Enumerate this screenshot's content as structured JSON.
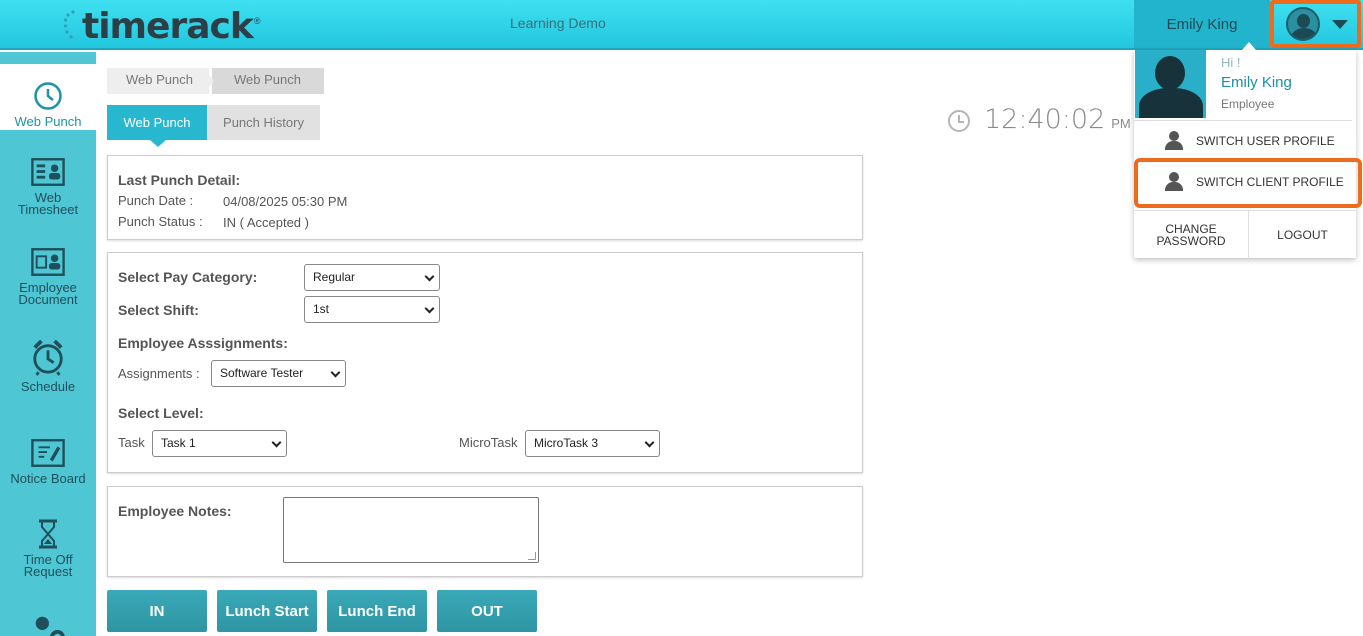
{
  "header": {
    "logo_text": "timerack",
    "logo_reg": "®",
    "org_name": "Learning Demo",
    "user_name": "Emily King"
  },
  "sidebar": {
    "items": [
      {
        "label": "Web Punch",
        "icon": "clock-icon",
        "active": true
      },
      {
        "label": "Web Timesheet",
        "icon": "timesheet-icon"
      },
      {
        "label": "Employee Document",
        "icon": "document-icon"
      },
      {
        "label": "Schedule",
        "icon": "alarm-clock-icon"
      },
      {
        "label": "Notice Board",
        "icon": "notice-board-icon"
      },
      {
        "label": "Time Off Request",
        "icon": "hourglass-icon"
      },
      {
        "label": "",
        "icon": "user-settings-icon"
      }
    ]
  },
  "breadcrumb": [
    "Web Punch",
    "Web Punch"
  ],
  "tabs": [
    {
      "label": "Web Punch",
      "active": true
    },
    {
      "label": "Punch History",
      "active": false
    }
  ],
  "clock": {
    "time": "12:40:02",
    "ampm": "PM"
  },
  "last_punch": {
    "title": "Last Punch Detail:",
    "date_label": "Punch Date :",
    "date_value": "04/08/2025 05:30 PM",
    "status_label": "Punch Status :",
    "status_value": "IN ( Accepted )"
  },
  "form": {
    "pay_category_label": "Select Pay Category:",
    "pay_category_value": "Regular",
    "shift_label": "Select Shift:",
    "shift_value": "1st",
    "assignments_title": "Employee Asssignments:",
    "assignments_label": "Assignments :",
    "assignments_value": "Software Tester",
    "level_title": "Select Level:",
    "task_label": "Task",
    "task_value": "Task 1",
    "microtask_label": "MicroTask",
    "microtask_value": "MicroTask 3"
  },
  "notes": {
    "label": "Employee Notes:"
  },
  "buttons": {
    "in": "IN",
    "lunch_start": "Lunch Start",
    "lunch_end": "Lunch End",
    "out": "OUT"
  },
  "dropdown": {
    "greeting": "Hi !",
    "name": "Emily King",
    "role": "Employee",
    "switch_user": "SWITCH USER PROFILE",
    "switch_client": "SWITCH CLIENT PROFILE",
    "change_password_1": "CHANGE",
    "change_password_2": "PASSWORD",
    "logout": "LOGOUT"
  },
  "colors": {
    "header": "#22c6de",
    "sidebar": "#4ec6d3",
    "accent": "#27b8d0",
    "highlight": "#ee6a1c",
    "button": "#3aa9b8"
  }
}
